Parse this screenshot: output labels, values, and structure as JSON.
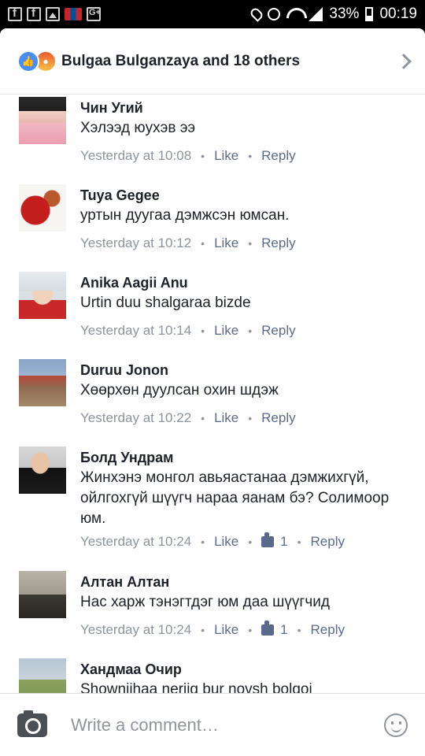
{
  "status_bar": {
    "battery": "33%",
    "time": "00:19"
  },
  "header": {
    "title": "Bulgaa Bulganzaya and 18 others"
  },
  "comments": [
    {
      "name": "Чин Угий",
      "text": "Хэлээд юухэв ээ",
      "time": "Yesterday at 10:08",
      "like_label": "Like",
      "reply_label": "Reply"
    },
    {
      "name": "Tuya Gegee",
      "text": "уртын дуугаа дэмжсэн юмсан.",
      "time": "Yesterday at 10:12",
      "like_label": "Like",
      "reply_label": "Reply"
    },
    {
      "name": "Anika Aagii Anu",
      "text": "Urtin duu shalgaraa bizde",
      "time": "Yesterday at 10:14",
      "like_label": "Like",
      "reply_label": "Reply"
    },
    {
      "name": "Duruu Jonon",
      "text": "Хөөрхөн дуулсан охин шдэж",
      "time": "Yesterday at 10:22",
      "like_label": "Like",
      "reply_label": "Reply"
    },
    {
      "name": "Болд Ундрам",
      "text": "Жинхэнэ монгол авьяастанаа дэмжихгүй, ойлгохгүй шүүгч нараа яанам бэ? Солимоор юм.",
      "time": "Yesterday at 10:24",
      "like_label": "Like",
      "like_count": "1",
      "reply_label": "Reply"
    },
    {
      "name": "Алтан Алтан",
      "text": "Нас харж тэнэгтдэг юм даа шүүгчид",
      "time": "Yesterday at 10:24",
      "like_label": "Like",
      "like_count": "1",
      "reply_label": "Reply"
    },
    {
      "name": "Хандмаа Очир",
      "text": "Shownjihaa neriig bur novsh bolgoi"
    }
  ],
  "composer": {
    "placeholder": "Write a comment…"
  }
}
